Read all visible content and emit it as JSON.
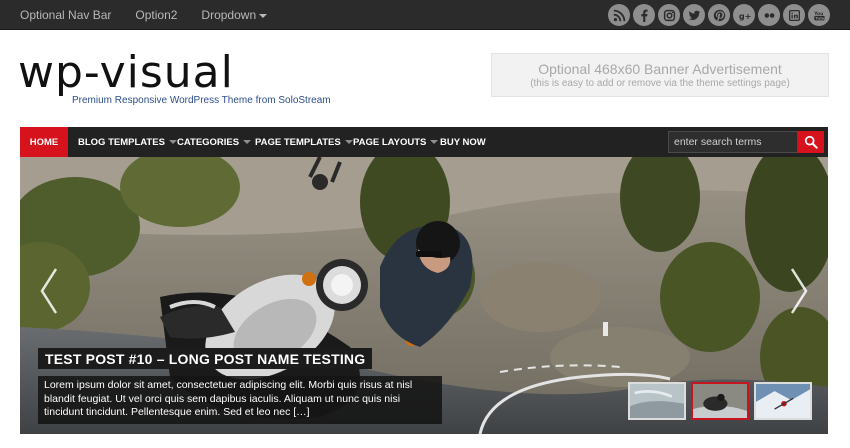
{
  "topbar": {
    "nav": [
      {
        "label": "Optional Nav Bar"
      },
      {
        "label": "Option2"
      },
      {
        "label": "Dropdown"
      }
    ],
    "social_icons": [
      "rss-icon",
      "facebook-icon",
      "instagram-icon",
      "twitter-icon",
      "pinterest-icon",
      "google-plus-icon",
      "flickr-icon",
      "linkedin-icon",
      "youtube-icon"
    ]
  },
  "header": {
    "logo": "wp-visual",
    "tagline": "Premium Responsive WordPress Theme from SoloStream",
    "banner_title": "Optional 468x60 Banner Advertisement",
    "banner_subtitle": "(this is easy to add or remove via the theme settings page)"
  },
  "mainnav": {
    "home": "HOME",
    "items": [
      {
        "label": "BLOG TEMPLATES"
      },
      {
        "label": "CATEGORIES"
      },
      {
        "label": "PAGE TEMPLATES"
      },
      {
        "label": "PAGE LAYOUTS"
      },
      {
        "label": "BUY NOW"
      }
    ],
    "search_placeholder": "enter search terms"
  },
  "slider": {
    "title": "TEST POST #10 – LONG POST NAME TESTING",
    "excerpt": "Lorem ipsum dolor sit amet, consectetuer adipiscing elit. Morbi quis risus at nisl blandit feugiat. Ut vel orci quis sem dapibus iaculis. Aliquam ut nunc quis nisi tincidunt tincidunt. Pellentesque enim. Sed et leo nec […]",
    "active_thumb": 2
  },
  "colors": {
    "accent": "#d6121c",
    "nav_bg": "#222222",
    "topbar_bg": "#2b2b2b",
    "tagline": "#2c4f8a"
  }
}
